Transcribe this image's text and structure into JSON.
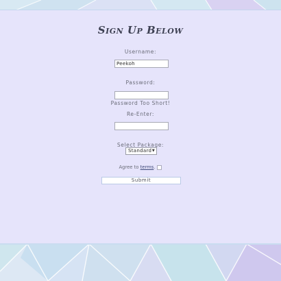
{
  "form": {
    "title": "Sign Up Below",
    "username_label": "Username:",
    "username_value": "Peekoh",
    "password_label": "Password:",
    "password_value": "",
    "password_error": "Password Too Short!",
    "reenter_label": "Re-Enter:",
    "reenter_value": "",
    "package_label": "Select Package:",
    "package_selected": "Standard",
    "agree_prefix": "Agree to ",
    "agree_link": "terms",
    "agree_suffix": ".",
    "agree_checked": false,
    "submit_label": "Submit"
  },
  "theme": {
    "panel_color": "#e6e4fb",
    "background_tint": "#cfe6f2",
    "title_color": "#3e4153"
  }
}
